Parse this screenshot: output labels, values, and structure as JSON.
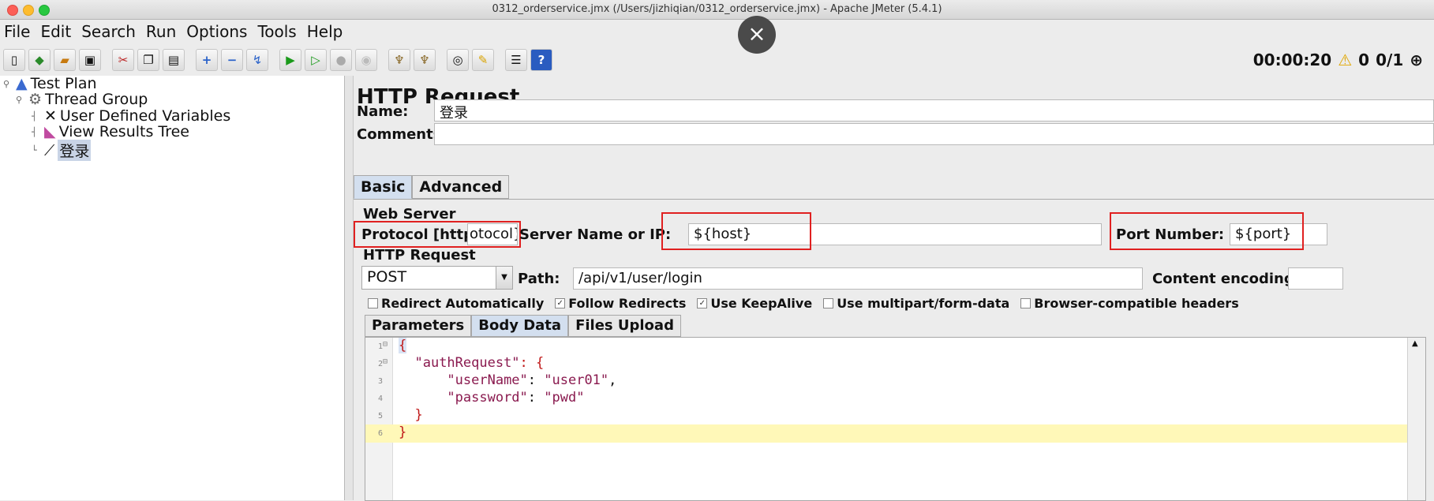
{
  "window": {
    "title": "0312_orderservice.jmx (/Users/jizhiqian/0312_orderservice.jmx) - Apache JMeter (5.4.1)"
  },
  "menu": [
    "File",
    "Edit",
    "Search",
    "Run",
    "Options",
    "Tools",
    "Help"
  ],
  "overlay_close": "×",
  "toolbar": {
    "icons": [
      "new-icon",
      "templates-icon",
      "open-icon",
      "save-icon",
      "cut-icon",
      "copy-icon",
      "paste-icon",
      "expand-icon",
      "collapse-icon",
      "toggle-icon",
      "start-icon",
      "start-no-pause-icon",
      "stop-icon",
      "shutdown-icon",
      "clear-icon",
      "clear-all-icon",
      "search-icon",
      "reset-search-icon",
      "function-helper-icon",
      "help-icon"
    ]
  },
  "status": {
    "elapsed": "00:00:20",
    "warnings": "0",
    "threads": "0/1"
  },
  "tree": {
    "test_plan": "Test Plan",
    "thread_group": "Thread Group",
    "udv": "User Defined Variables",
    "view_results": "View Results Tree",
    "sampler": "登录"
  },
  "panel": {
    "title": "HTTP Request",
    "name_label": "Name:",
    "name_value": "登录",
    "comments_label": "Comments:",
    "comments_value": "",
    "tabs": [
      "Basic",
      "Advanced"
    ],
    "web_server_title": "Web Server",
    "protocol_label": "Protocol [http]:",
    "protocol_value": "otocol}",
    "server_label": "Server Name or IP:",
    "server_value": "${host}",
    "port_label": "Port Number:",
    "port_value": "${port}",
    "http_request_title": "HTTP Request",
    "method": "POST",
    "path_label": "Path:",
    "path_value": "/api/v1/user/login",
    "encoding_label": "Content encoding:",
    "encoding_value": "",
    "checkboxes": [
      {
        "label": "Redirect Automatically",
        "checked": false
      },
      {
        "label": "Follow Redirects",
        "checked": true
      },
      {
        "label": "Use KeepAlive",
        "checked": true
      },
      {
        "label": "Use multipart/form-data",
        "checked": false
      },
      {
        "label": "Browser-compatible headers",
        "checked": false
      }
    ],
    "subtabs": [
      "Parameters",
      "Body Data",
      "Files Upload"
    ]
  },
  "body": {
    "lines": [
      {
        "num": "1",
        "indent": "",
        "text": "{"
      },
      {
        "num": "2",
        "indent": "  ",
        "key": "\"authRequest\"",
        "rest": ": {"
      },
      {
        "num": "3",
        "indent": "      ",
        "key": "\"userName\"",
        "colon": ": ",
        "val": "\"user01\"",
        "tail": ","
      },
      {
        "num": "4",
        "indent": "      ",
        "key": "\"password\"",
        "colon": ": ",
        "val": "\"pwd\"",
        "tail": ""
      },
      {
        "num": "5",
        "indent": "  ",
        "text": "}"
      },
      {
        "num": "6",
        "indent": "",
        "text": "}"
      }
    ]
  }
}
